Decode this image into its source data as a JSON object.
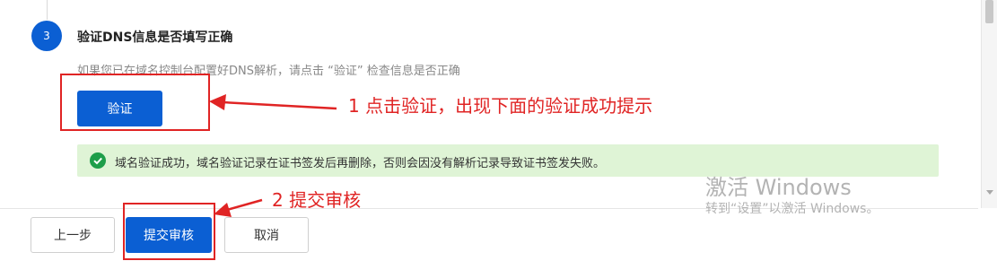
{
  "step": {
    "number": "3",
    "title": "验证DNS信息是否填写正确",
    "description": "如果您已在域名控制台配置好DNS解析，请点击 “验证” 检查信息是否正确"
  },
  "verify_button": {
    "label": "验证"
  },
  "success_message": {
    "text": "域名验证成功，域名验证记录在证书签发后再删除，否则会因没有解析记录导致证书签发失败。",
    "icon": "check-circle-icon"
  },
  "annotations": {
    "verify_hint": "1 点击验证，出现下面的验证成功提示",
    "submit_hint": "2 提交审核"
  },
  "footer": {
    "prev_label": "上一步",
    "submit_label": "提交审核",
    "cancel_label": "取消"
  },
  "watermark": {
    "title": "激活 Windows",
    "subtitle": "转到“设置”以激活 Windows。"
  },
  "colors": {
    "primary": "#0b5fd3",
    "annotation_red": "#e02424",
    "success_bg": "#dff4d6",
    "success_icon": "#1e9e4a"
  }
}
